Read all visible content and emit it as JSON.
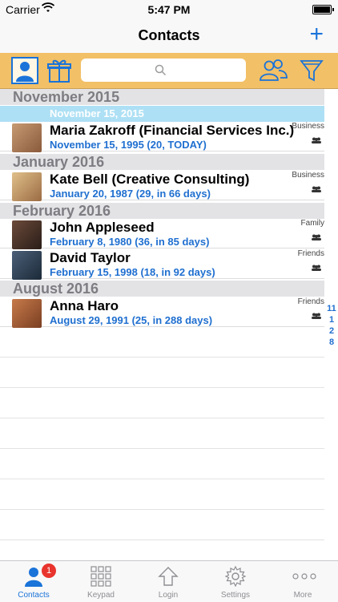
{
  "status": {
    "carrier": "Carrier",
    "time": "5:47 PM"
  },
  "nav": {
    "title": "Contacts",
    "add_label": "+"
  },
  "search": {
    "placeholder": ""
  },
  "sections": [
    {
      "label": "November 2015",
      "date_header": "November 15, 2015"
    },
    {
      "label": "January 2016"
    },
    {
      "label": "February 2016"
    },
    {
      "label": "August 2016"
    }
  ],
  "contacts": [
    {
      "name": "Maria Zakroff (Financial Services Inc.)",
      "date": "November 15, 1995 (20, TODAY)",
      "group": "Business"
    },
    {
      "name": "Kate Bell (Creative Consulting)",
      "date": "January 20, 1987 (29, in 66 days)",
      "group": "Business"
    },
    {
      "name": "John Appleseed",
      "date": "February 8, 1980 (36, in 85 days)",
      "group": "Family"
    },
    {
      "name": "David Taylor",
      "date": "February 15, 1998 (18, in 92 days)",
      "group": "Friends"
    },
    {
      "name": "Anna Haro",
      "date": "August 29, 1991 (25, in 288 days)",
      "group": "Friends"
    }
  ],
  "index": [
    "11",
    "1",
    "2",
    "8"
  ],
  "tabs": [
    {
      "label": "Contacts",
      "badge": "1"
    },
    {
      "label": "Keypad"
    },
    {
      "label": "Login"
    },
    {
      "label": "Settings"
    },
    {
      "label": "More"
    }
  ],
  "colors": {
    "accent": "#1a73d9",
    "toolbar": "#f2c067",
    "date_blue": "#1f6fd0",
    "badge": "#e8342d"
  }
}
